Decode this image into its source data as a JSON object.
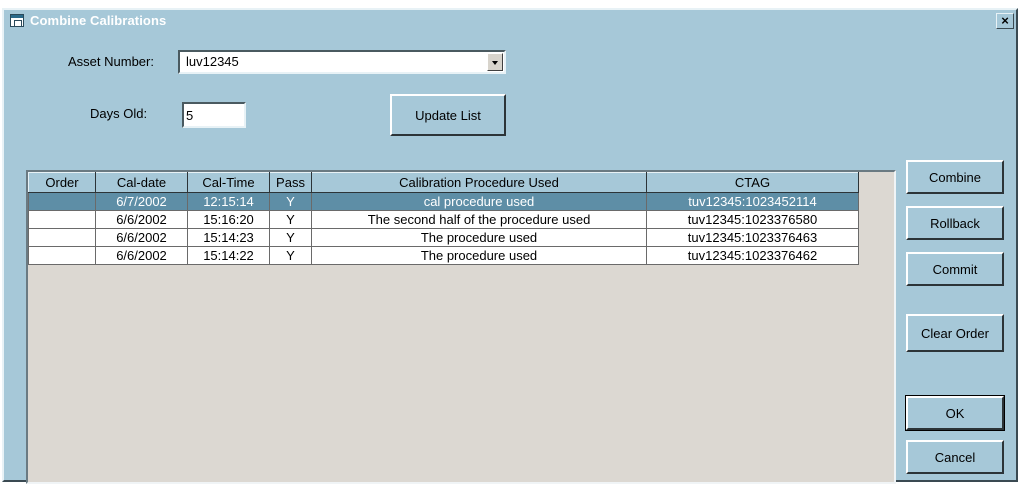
{
  "window": {
    "title": "Combine Calibrations",
    "close_label": "×"
  },
  "form": {
    "asset_number_label": "Asset Number:",
    "asset_number_value": "luv12345",
    "days_old_label": "Days Old:",
    "days_old_value": "5",
    "update_list_label": "Update List"
  },
  "table": {
    "columns": [
      "Order",
      "Cal-date",
      "Cal-Time",
      "Pass",
      "Calibration Procedure Used",
      "CTAG"
    ],
    "rows": [
      {
        "order": "",
        "date": "6/7/2002",
        "time": "12:15:14",
        "pass": "Y",
        "procedure": "cal procedure used",
        "ctag": "tuv12345:1023452114",
        "selected": true
      },
      {
        "order": "",
        "date": "6/6/2002",
        "time": "15:16:20",
        "pass": "Y",
        "procedure": "The second half of the procedure used",
        "ctag": "tuv12345:1023376580",
        "selected": false
      },
      {
        "order": "",
        "date": "6/6/2002",
        "time": "15:14:23",
        "pass": "Y",
        "procedure": "The procedure used",
        "ctag": "tuv12345:1023376463",
        "selected": false
      },
      {
        "order": "",
        "date": "6/6/2002",
        "time": "15:14:22",
        "pass": "Y",
        "procedure": "The procedure used",
        "ctag": "tuv12345:1023376462",
        "selected": false
      }
    ]
  },
  "buttons": {
    "combine": "Combine",
    "rollback": "Rollback",
    "commit": "Commit",
    "clear_order": "Clear Order",
    "ok": "OK",
    "cancel": "Cancel"
  },
  "colors": {
    "dialog_background": "#a6c8d8",
    "selected_row": "#5e8ea6",
    "grid_background": "#dcd8d2"
  },
  "icons": {
    "window": "window-icon",
    "dropdown": "chevron-down-icon"
  }
}
